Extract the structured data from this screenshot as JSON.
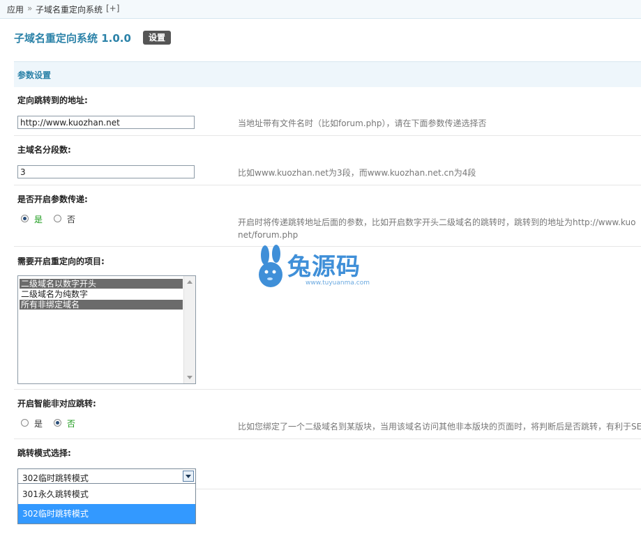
{
  "breadcrumb": {
    "app": "应用",
    "sep": "»",
    "current": "子域名重定向系统",
    "add": "[+]"
  },
  "header": {
    "title": "子域名重定向系统 1.0.0",
    "settings_button": "设置"
  },
  "section": {
    "title": "参数设置"
  },
  "fields": {
    "redirect_url": {
      "label": "定向跳转到的地址:",
      "value": "http://www.kuozhan.net",
      "tip": "当地址带有文件名时（比如forum.php），请在下面参数传递选择否"
    },
    "domain_segments": {
      "label": "主域名分段数:",
      "value": "3",
      "tip": "比如www.kuozhan.net为3段，而www.kuozhan.net.cn为4段"
    },
    "pass_params": {
      "label": "是否开启参数传递:",
      "yes": "是",
      "no": "否",
      "selected": "yes",
      "tip_line1": "开启时将传递跳转地址后面的参数，比如开启数字开头二级域名的跳转时，跳转到的地址为http://www.kuo",
      "tip_line2": "net/forum.php"
    },
    "redirect_items": {
      "label": "需要开启重定向的项目:",
      "options": [
        {
          "label": "二级域名以数字开头",
          "selected": true
        },
        {
          "label": "二级域名为纯数字",
          "selected": false
        },
        {
          "label": "所有非绑定域名",
          "selected": true
        }
      ]
    },
    "smart_redirect": {
      "label": "开启智能非对应跳转:",
      "yes": "是",
      "no": "否",
      "selected": "no",
      "tip": "比如您绑定了一个二级域名到某版块，当用该域名访问其他非本版块的页面时，将判断后是否跳转，有利于SE"
    },
    "redirect_mode": {
      "label": "跳转模式选择:",
      "selected": "302临时跳转模式",
      "options": [
        "301永久跳转模式",
        "302临时跳转模式"
      ],
      "highlighted": "302临时跳转模式"
    }
  },
  "watermark": {
    "text": "兔源码",
    "url": "www.tuyuanma.com"
  },
  "colors": {
    "accent": "#2b82a8",
    "highlight": "#3399ff",
    "green": "#1a9a1a"
  }
}
